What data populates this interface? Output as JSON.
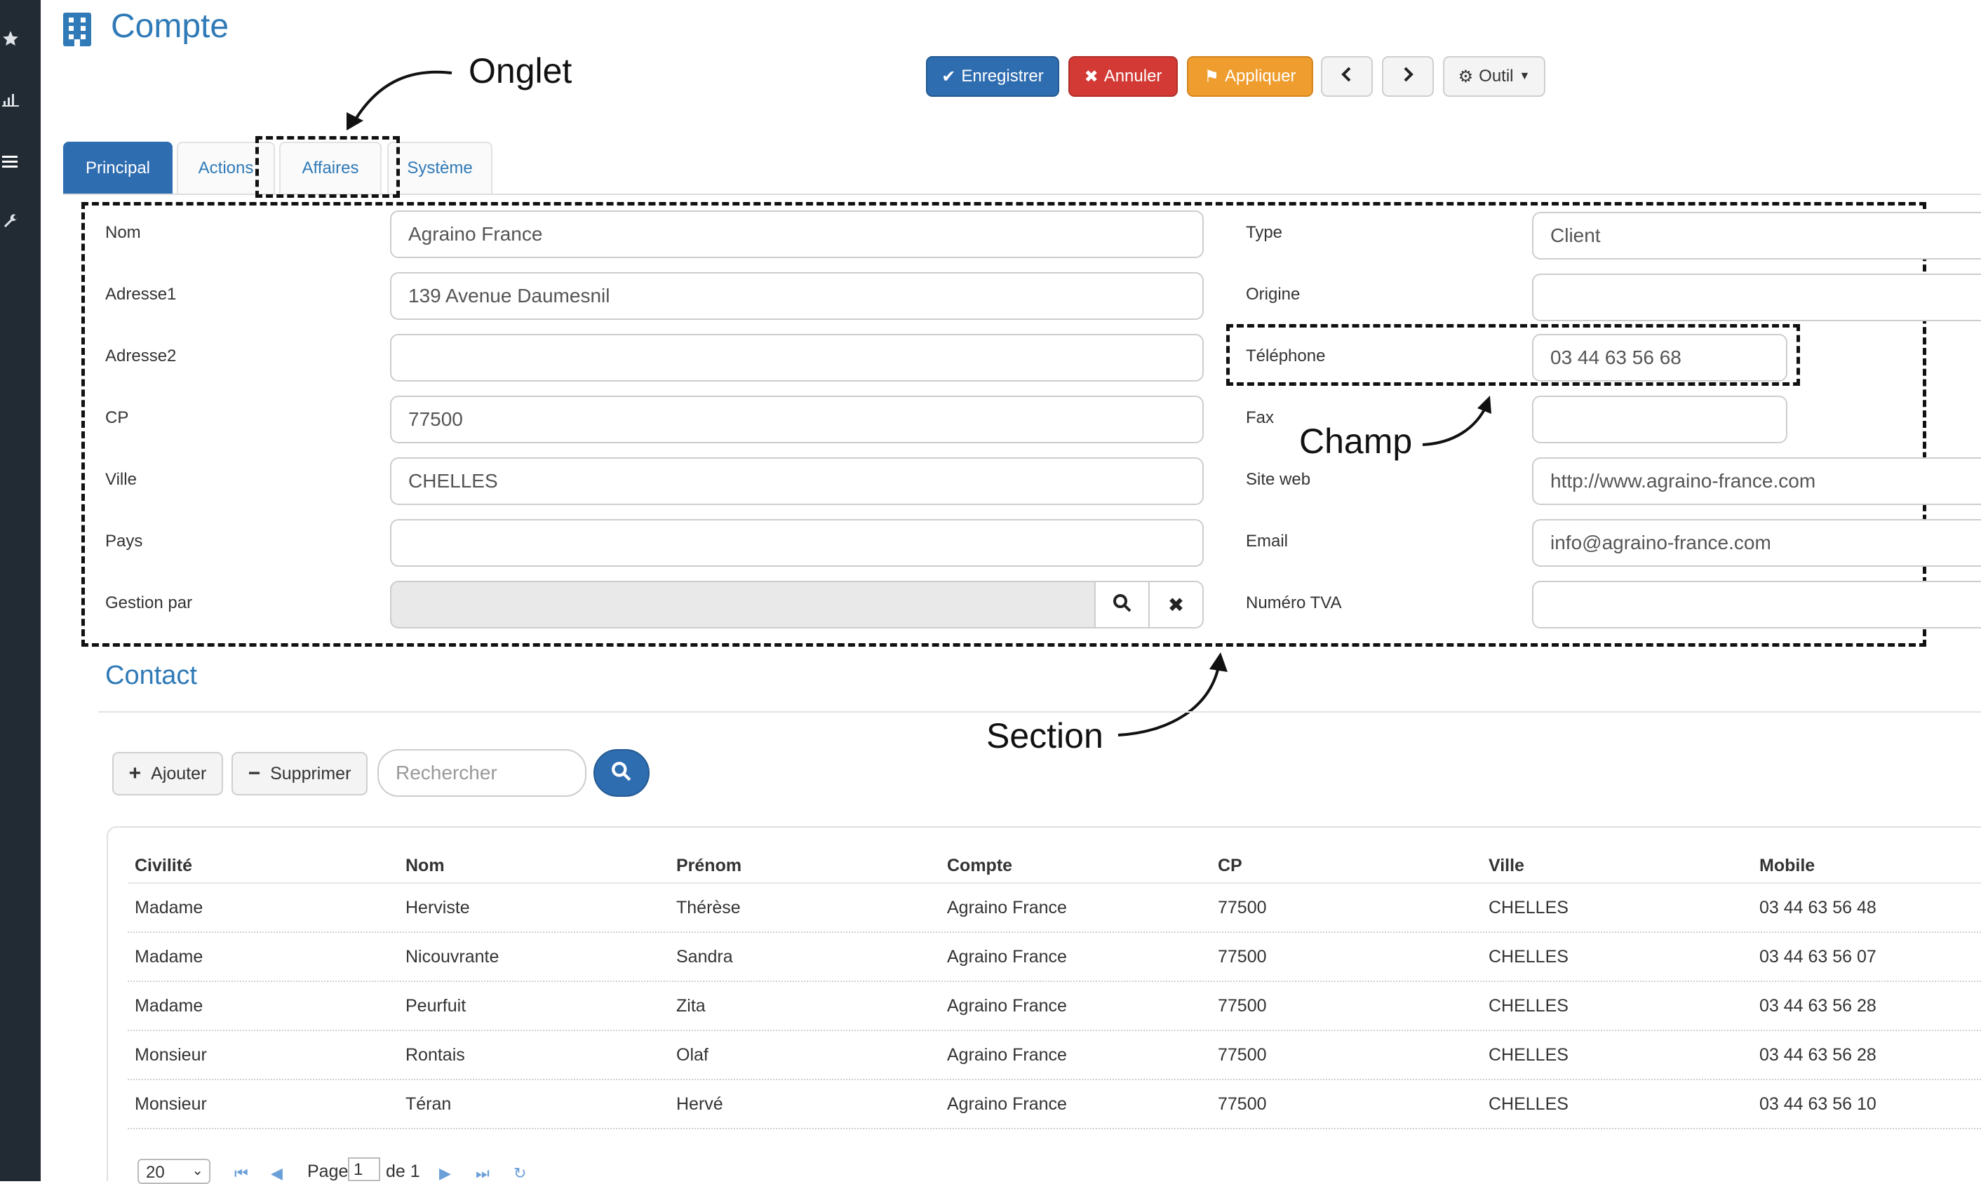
{
  "header": {
    "title": "Compte",
    "icon": "building-icon",
    "toolbar": {
      "save": "Enregistrer",
      "cancel": "Annuler",
      "apply": "Appliquer",
      "tool": "Outil"
    }
  },
  "tabs": [
    "Principal",
    "Actions",
    "Affaires",
    "Système"
  ],
  "form": {
    "left": [
      {
        "label": "Nom",
        "value": "Agraino France"
      },
      {
        "label": "Adresse1",
        "value": "139 Avenue Daumesnil"
      },
      {
        "label": "Adresse2",
        "value": ""
      },
      {
        "label": "CP",
        "value": "77500"
      },
      {
        "label": "Ville",
        "value": "CHELLES"
      },
      {
        "label": "Pays",
        "value": ""
      },
      {
        "label": "Gestion par",
        "value": ""
      }
    ],
    "right": [
      {
        "label": "Type",
        "value": "Client"
      },
      {
        "label": "Origine",
        "value": ""
      },
      {
        "label": "Téléphone",
        "value": "03 44 63 56 68"
      },
      {
        "label": "Fax",
        "value": ""
      },
      {
        "label": "Site web",
        "value": "http://www.agraino-france.com"
      },
      {
        "label": "Email",
        "value": "info@agraino-france.com"
      },
      {
        "label": "Numéro TVA",
        "value": ""
      }
    ]
  },
  "annotations": {
    "tab": "Onglet",
    "field": "Champ",
    "section": "Section"
  },
  "contact": {
    "title": "Contact",
    "add": "Ajouter",
    "remove": "Supprimer",
    "search_placeholder": "Rechercher",
    "columns": [
      "Civilité",
      "Nom",
      "Prénom",
      "Compte",
      "CP",
      "Ville",
      "Mobile"
    ],
    "rows": [
      [
        "Madame",
        "Herviste",
        "Thérèse",
        "Agraino France",
        "77500",
        "CHELLES",
        "03 44 63 56 48"
      ],
      [
        "Madame",
        "Nicouvrante",
        "Sandra",
        "Agraino France",
        "77500",
        "CHELLES",
        "03 44 63 56 07"
      ],
      [
        "Madame",
        "Peurfuit",
        "Zita",
        "Agraino France",
        "77500",
        "CHELLES",
        "03 44 63 56 28"
      ],
      [
        "Monsieur",
        "Rontais",
        "Olaf",
        "Agraino France",
        "77500",
        "CHELLES",
        "03 44 63 56 28"
      ],
      [
        "Monsieur",
        "Téran",
        "Hervé",
        "Agraino France",
        "77500",
        "CHELLES",
        "03 44 63 56 10"
      ]
    ],
    "pager": {
      "page_size": "20",
      "page_label": "Page",
      "page_value": "1",
      "of_label": "de 1"
    }
  }
}
